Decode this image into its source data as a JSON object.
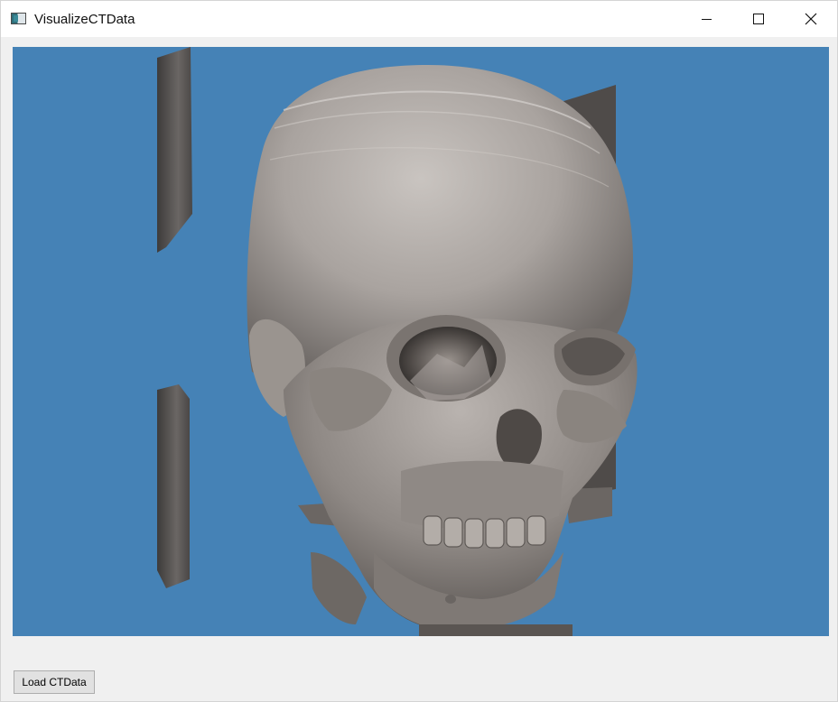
{
  "window": {
    "title": "VisualizeCTData"
  },
  "icons": {
    "app": "app-window-icon",
    "minimize": "minimize-icon",
    "maximize": "maximize-icon",
    "close": "close-icon"
  },
  "viewport": {
    "background_color": "#4582b6",
    "content": "skull-volume-render"
  },
  "controls": {
    "load_button_label": "Load CTData"
  }
}
